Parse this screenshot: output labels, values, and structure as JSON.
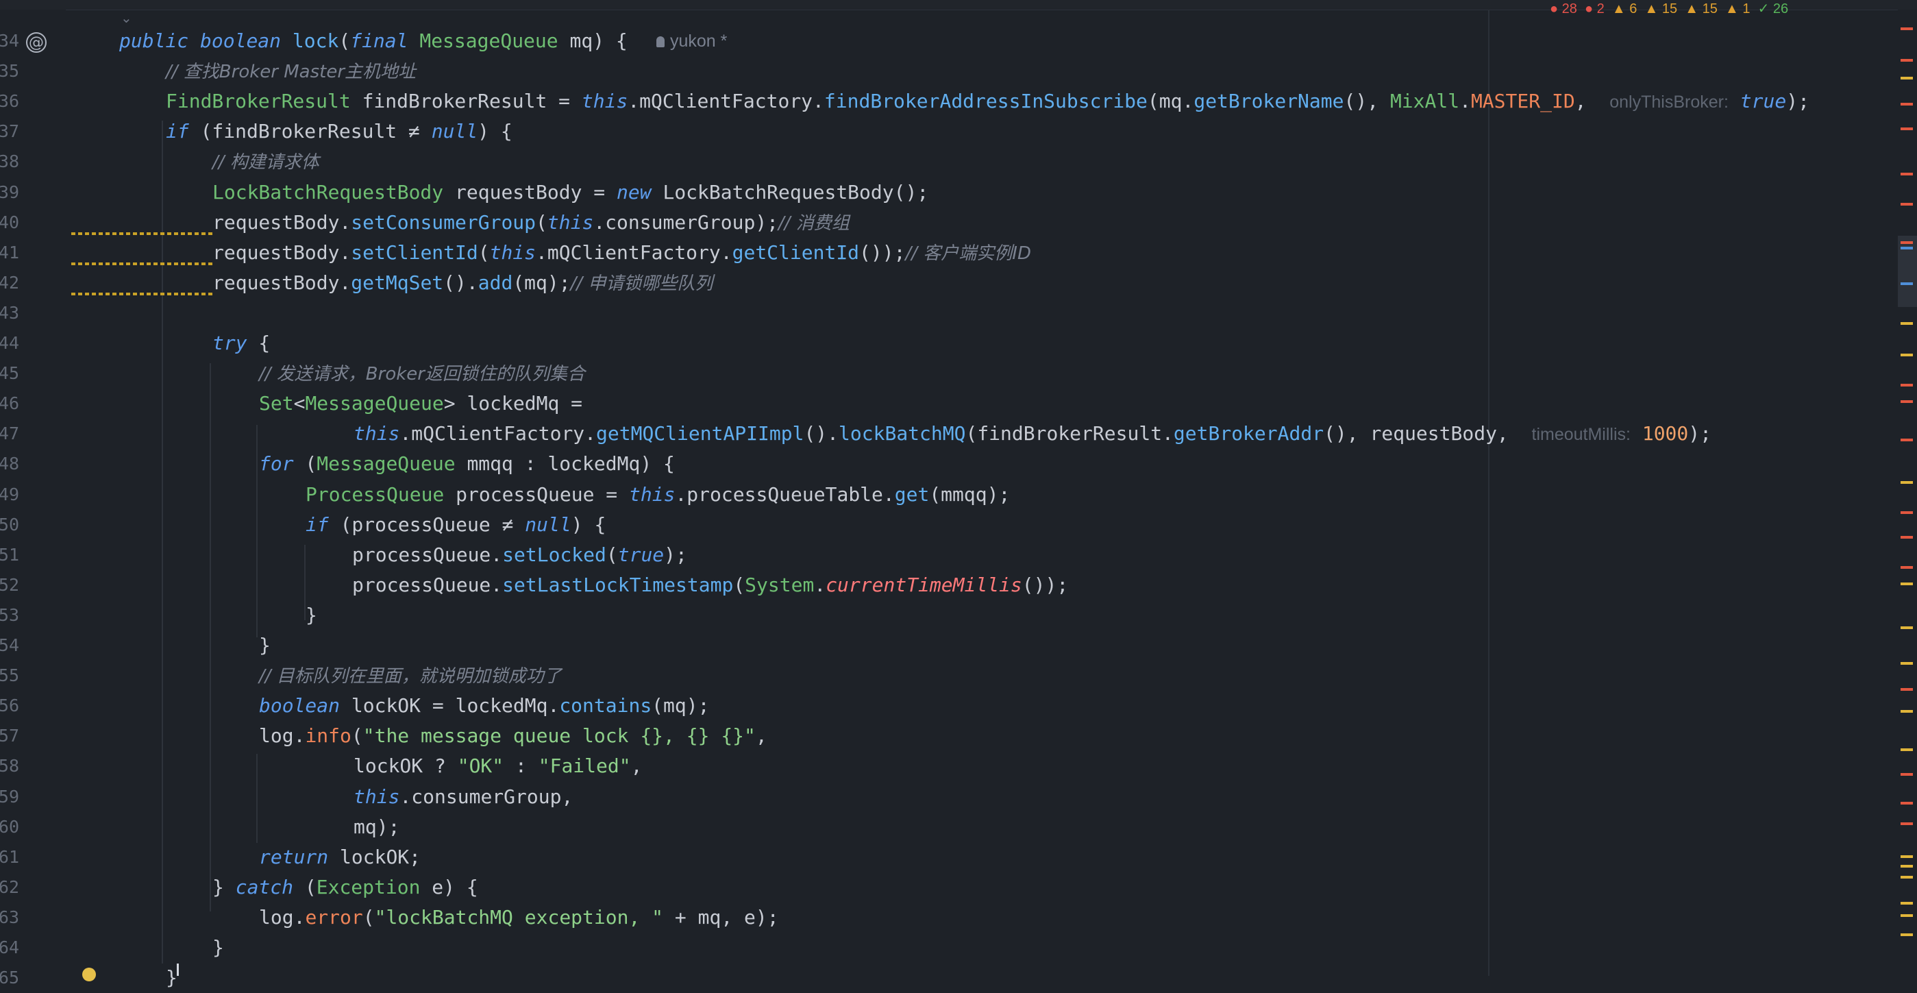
{
  "editor": {
    "author_hint": "yukon *",
    "inspections": {
      "errors": "28",
      "errors2": "2",
      "warn1": "6",
      "warn2": "15",
      "warn3": "15",
      "warn4": "1",
      "ok": "26"
    },
    "lines": [
      {
        "n": "34",
        "t": [
          [
            "kw",
            "public"
          ],
          [
            "op",
            " "
          ],
          [
            "kw",
            "boolean"
          ],
          [
            "op",
            " "
          ],
          [
            "fn",
            "lock"
          ],
          [
            "op",
            "("
          ],
          [
            "kw",
            "final"
          ],
          [
            "op",
            " "
          ],
          [
            "ty",
            "MessageQueue"
          ],
          [
            "op",
            " mq) {"
          ]
        ]
      },
      {
        "n": "35",
        "t": [
          [
            "cm",
            "// 查找"
          ],
          [
            "cm",
            "Broker Master"
          ],
          [
            "cm",
            "主机地址"
          ]
        ]
      },
      {
        "n": "36",
        "t": [
          [
            "ty",
            "FindBrokerResult"
          ],
          [
            "op",
            " findBrokerResult = "
          ],
          [
            "kw",
            "this"
          ],
          [
            "op",
            ".mQClientFactory."
          ],
          [
            "fn",
            "findBrokerAddressInSubscribe"
          ],
          [
            "op",
            "(mq."
          ],
          [
            "fn",
            "getBrokerName"
          ],
          [
            "op",
            "(), "
          ],
          [
            "ty",
            "MixAll"
          ],
          [
            "op",
            "."
          ],
          [
            "cst",
            "MASTER_ID"
          ],
          [
            "op",
            ",  "
          ],
          [
            "hint",
            "onlyThisBroker:"
          ],
          [
            "op",
            " "
          ],
          [
            "kw",
            "true"
          ],
          [
            "op",
            ");"
          ]
        ]
      },
      {
        "n": "37",
        "t": [
          [
            "kw",
            "if"
          ],
          [
            "op",
            " (findBrokerResult ≠ "
          ],
          [
            "kw",
            "null"
          ],
          [
            "op",
            ") {"
          ]
        ]
      },
      {
        "n": "38",
        "t": [
          [
            "cm",
            "// 构建请求体"
          ]
        ]
      },
      {
        "n": "39",
        "t": [
          [
            "ty",
            "LockBatchRequestBody"
          ],
          [
            "op",
            " requestBody = "
          ],
          [
            "kw",
            "new"
          ],
          [
            "op",
            " LockBatchRequestBody();"
          ]
        ]
      },
      {
        "n": "40",
        "t": [
          [
            "op",
            "requestBody."
          ],
          [
            "fn",
            "setConsumerGroup"
          ],
          [
            "op",
            "("
          ],
          [
            "kw",
            "this"
          ],
          [
            "op",
            ".consumerGroup);"
          ],
          [
            "cm",
            "// 消费组"
          ]
        ]
      },
      {
        "n": "41",
        "t": [
          [
            "op",
            "requestBody."
          ],
          [
            "fn",
            "setClientId"
          ],
          [
            "op",
            "("
          ],
          [
            "kw",
            "this"
          ],
          [
            "op",
            ".mQClientFactory."
          ],
          [
            "fn",
            "getClientId"
          ],
          [
            "op",
            "());"
          ],
          [
            "cm",
            "// 客户端实例"
          ],
          [
            "cm",
            "ID"
          ]
        ]
      },
      {
        "n": "42",
        "t": [
          [
            "op",
            "requestBody."
          ],
          [
            "fn",
            "getMqSet"
          ],
          [
            "op",
            "()."
          ],
          [
            "fn",
            "add"
          ],
          [
            "op",
            "(mq);"
          ],
          [
            "cm",
            "// 申请锁哪些队列"
          ]
        ]
      },
      {
        "n": "43",
        "t": []
      },
      {
        "n": "44",
        "t": [
          [
            "kw",
            "try"
          ],
          [
            "op",
            " {"
          ]
        ]
      },
      {
        "n": "45",
        "t": [
          [
            "cm",
            "// 发送请求，"
          ],
          [
            "cm",
            "Broker"
          ],
          [
            "cm",
            "返回锁住的队列集合"
          ]
        ]
      },
      {
        "n": "46",
        "t": [
          [
            "ty",
            "Set"
          ],
          [
            "op",
            "<"
          ],
          [
            "ty",
            "MessageQueue"
          ],
          [
            "op",
            "> lockedMq ="
          ]
        ]
      },
      {
        "n": "47",
        "t": [
          [
            "kw",
            "this"
          ],
          [
            "op",
            ".mQClientFactory."
          ],
          [
            "fn",
            "getMQClientAPIImpl"
          ],
          [
            "op",
            "()."
          ],
          [
            "fn",
            "lockBatchMQ"
          ],
          [
            "op",
            "(findBrokerResult."
          ],
          [
            "fn",
            "getBrokerAddr"
          ],
          [
            "op",
            "(), requestBody,  "
          ],
          [
            "hint",
            "timeoutMillis:"
          ],
          [
            "op",
            " "
          ],
          [
            "nu",
            "1000"
          ],
          [
            "op",
            ");"
          ]
        ]
      },
      {
        "n": "48",
        "t": [
          [
            "kw",
            "for"
          ],
          [
            "op",
            " ("
          ],
          [
            "ty",
            "MessageQueue"
          ],
          [
            "op",
            " mmqq : lockedMq) {"
          ]
        ]
      },
      {
        "n": "49",
        "t": [
          [
            "ty",
            "ProcessQueue"
          ],
          [
            "op",
            " processQueue = "
          ],
          [
            "kw",
            "this"
          ],
          [
            "op",
            ".processQueueTable."
          ],
          [
            "fn",
            "get"
          ],
          [
            "op",
            "(mmqq);"
          ]
        ]
      },
      {
        "n": "50",
        "t": [
          [
            "kw",
            "if"
          ],
          [
            "op",
            " (processQueue ≠ "
          ],
          [
            "kw",
            "null"
          ],
          [
            "op",
            ") {"
          ]
        ]
      },
      {
        "n": "51",
        "t": [
          [
            "op",
            "processQueue."
          ],
          [
            "fn",
            "setLocked"
          ],
          [
            "op",
            "("
          ],
          [
            "kw",
            "true"
          ],
          [
            "op",
            ");"
          ]
        ]
      },
      {
        "n": "52",
        "t": [
          [
            "op",
            "processQueue."
          ],
          [
            "fn",
            "setLastLockTimestamp"
          ],
          [
            "op",
            "("
          ],
          [
            "ty",
            "System"
          ],
          [
            "op",
            "."
          ],
          [
            "stat",
            "currentTimeMillis"
          ],
          [
            "op",
            "());"
          ]
        ]
      },
      {
        "n": "53",
        "t": [
          [
            "op",
            "}"
          ]
        ]
      },
      {
        "n": "54",
        "t": [
          [
            "op",
            "}"
          ]
        ]
      },
      {
        "n": "55",
        "t": [
          [
            "cm",
            "// 目标队列在里面，就说明加锁成功了"
          ]
        ]
      },
      {
        "n": "56",
        "t": [
          [
            "kw",
            "boolean"
          ],
          [
            "op",
            " lockOK = lockedMq."
          ],
          [
            "fn",
            "contains"
          ],
          [
            "op",
            "(mq);"
          ]
        ]
      },
      {
        "n": "57",
        "t": [
          [
            "op",
            "log."
          ],
          [
            "cst",
            "info"
          ],
          [
            "op",
            "("
          ],
          [
            "st",
            "\"the message queue lock {}, {} {}\""
          ],
          [
            "op",
            ","
          ]
        ]
      },
      {
        "n": "58",
        "t": [
          [
            "op",
            "lockOK ? "
          ],
          [
            "st",
            "\"OK\""
          ],
          [
            "op",
            " : "
          ],
          [
            "st",
            "\"Failed\""
          ],
          [
            "op",
            ","
          ]
        ]
      },
      {
        "n": "59",
        "t": [
          [
            "kw",
            "this"
          ],
          [
            "op",
            ".consumerGroup,"
          ]
        ]
      },
      {
        "n": "60",
        "t": [
          [
            "op",
            "mq);"
          ]
        ]
      },
      {
        "n": "61",
        "t": [
          [
            "kw",
            "return"
          ],
          [
            "op",
            " lockOK;"
          ]
        ]
      },
      {
        "n": "62",
        "t": [
          [
            "op",
            "} "
          ],
          [
            "kw",
            "catch"
          ],
          [
            "op",
            " ("
          ],
          [
            "ty",
            "Exception"
          ],
          [
            "op",
            " e) {"
          ]
        ]
      },
      {
        "n": "63",
        "t": [
          [
            "op",
            "log."
          ],
          [
            "cst",
            "error"
          ],
          [
            "op",
            "("
          ],
          [
            "st",
            "\"lockBatchMQ exception, \""
          ],
          [
            "op",
            " + mq, e);"
          ]
        ]
      },
      {
        "n": "64",
        "t": [
          [
            "op",
            "}"
          ]
        ]
      },
      {
        "n": "65",
        "t": [
          [
            "op",
            "}"
          ]
        ]
      }
    ]
  }
}
